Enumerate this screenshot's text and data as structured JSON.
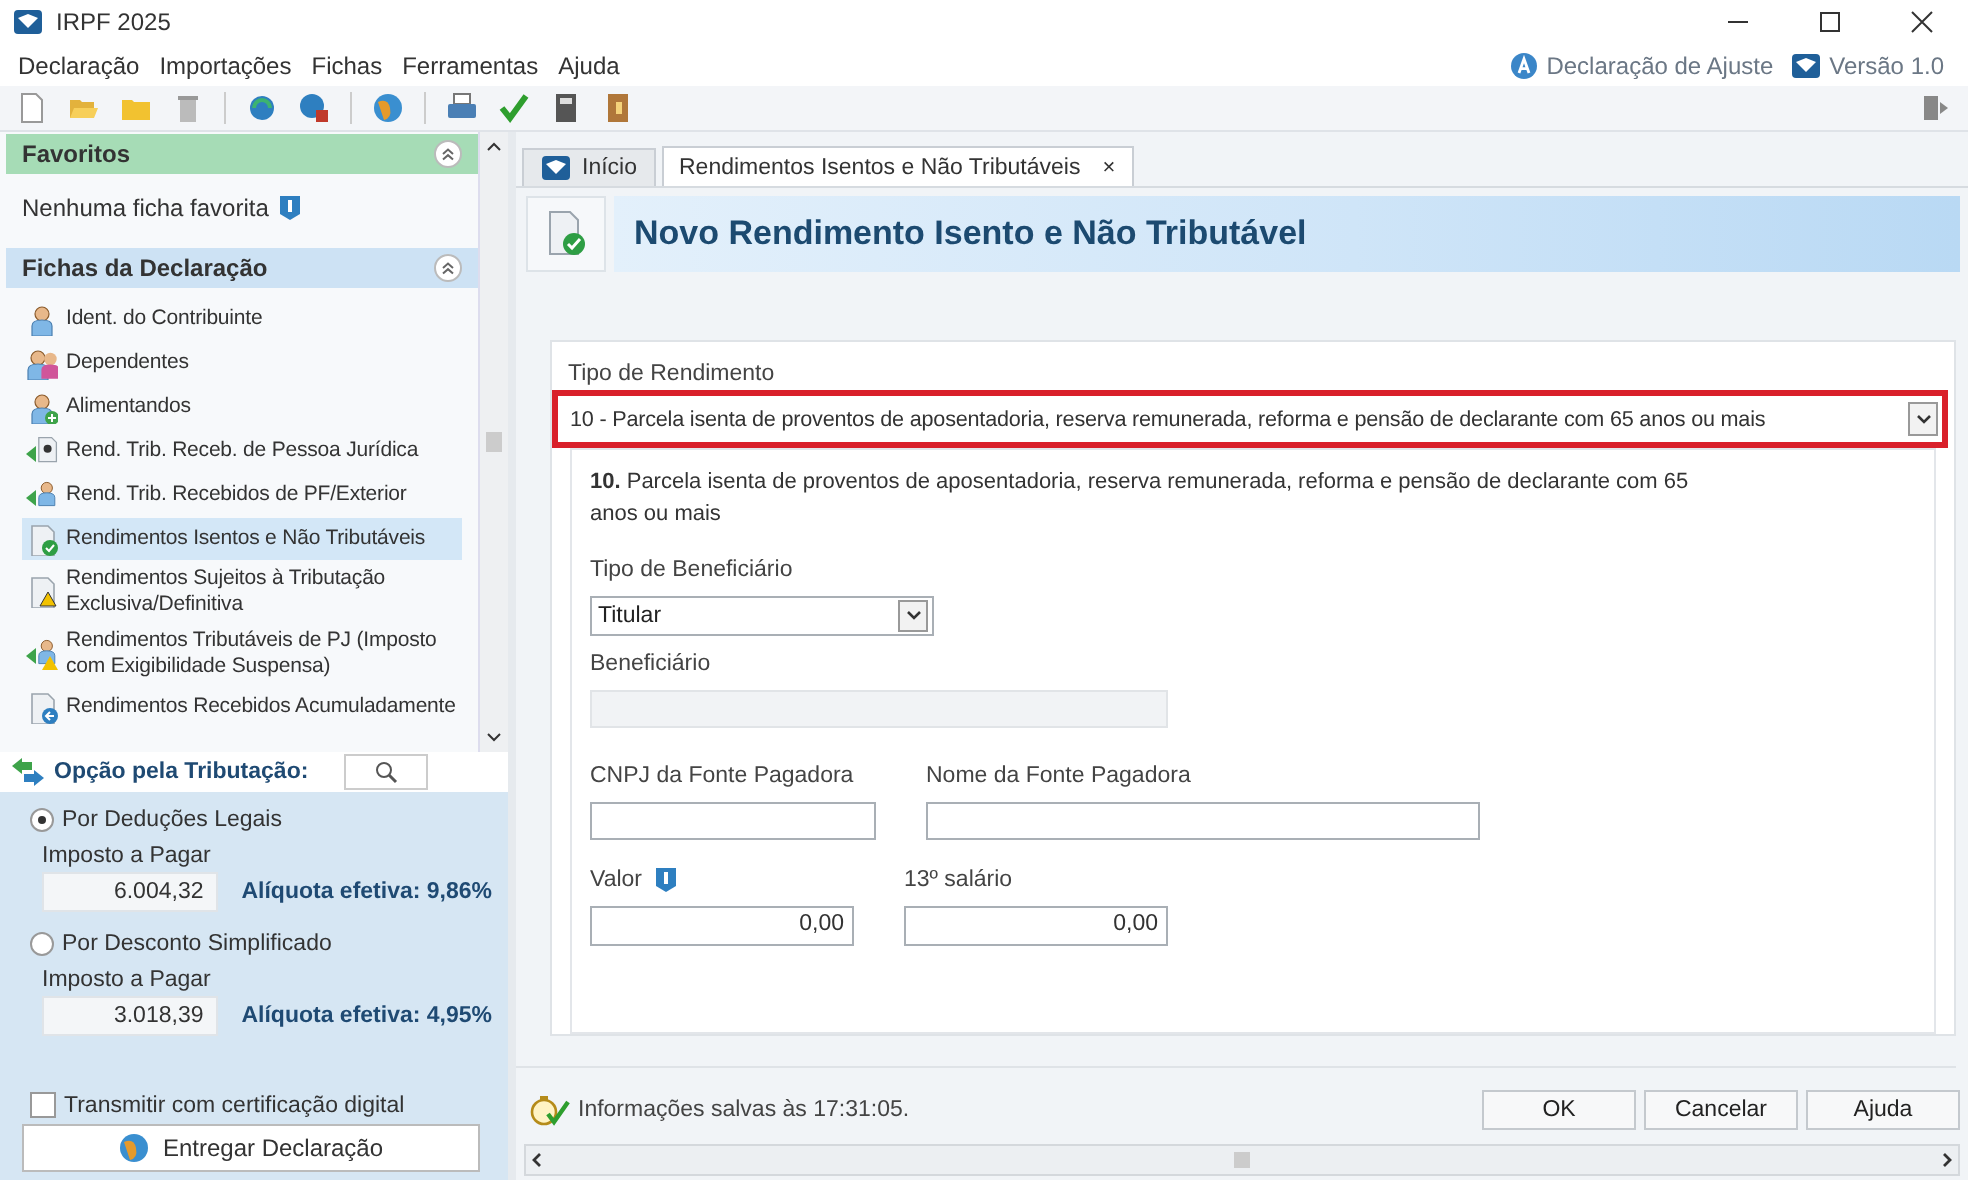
{
  "window": {
    "title": "IRPF 2025"
  },
  "menu": [
    "Declaração",
    "Importações",
    "Fichas",
    "Ferramentas",
    "Ajuda"
  ],
  "header_links": [
    "Declaração de Ajuste",
    "Versão 1.0"
  ],
  "favorites": {
    "title": "Favoritos",
    "empty_text": "Nenhuma ficha favorita"
  },
  "fichas": {
    "title": "Fichas da Declaração",
    "items": [
      {
        "label": "Ident. do Contribuinte",
        "selected": false
      },
      {
        "label": "Dependentes",
        "selected": false
      },
      {
        "label": "Alimentandos",
        "selected": false
      },
      {
        "label": "Rend. Trib. Receb. de Pessoa Jurídica",
        "selected": false
      },
      {
        "label": "Rend. Trib. Recebidos de PF/Exterior",
        "selected": false
      },
      {
        "label": "Rendimentos Isentos e Não Tributáveis",
        "selected": true
      },
      {
        "label": "Rendimentos Sujeitos à Tributação Exclusiva/Definitiva",
        "selected": false
      },
      {
        "label": "Rendimentos Tributáveis de PJ (Imposto com Exigibilidade Suspensa)",
        "selected": false
      },
      {
        "label": "Rendimentos Recebidos Acumuladamente",
        "selected": false
      }
    ]
  },
  "tax_option": {
    "title": "Opção pela Tributação:",
    "options": [
      {
        "label": "Por Deduções Legais",
        "selected": true,
        "amount_label": "Imposto a Pagar",
        "amount": "6.004,32",
        "rate": "Alíquota efetiva: 9,86%"
      },
      {
        "label": "Por Desconto Simplificado",
        "selected": false,
        "amount_label": "Imposto a Pagar",
        "amount": "3.018,39",
        "rate": "Alíquota efetiva: 4,95%"
      }
    ]
  },
  "certificate": {
    "label": "Transmitir com certificação digital",
    "checked": false
  },
  "submit_button": "Entregar Declaração",
  "tabs": [
    {
      "label": "Início",
      "selected": false
    },
    {
      "label": "Rendimentos Isentos e Não Tributáveis",
      "selected": true,
      "close": "×"
    }
  ],
  "page_title": "Novo Rendimento Isento e Não Tributável",
  "form": {
    "type_label": "Tipo de Rendimento",
    "type_value": "10 - Parcela isenta de proventos de aposentadoria, reserva remunerada, reforma e pensão de declarante com 65 anos ou mais",
    "type_highlighted": true,
    "description": "**10.** Parcela isenta de proventos de aposentadoria, reserva remunerada, reforma e pensão de declarante com 65 anos ou mais",
    "beneficiary_type": {
      "label": "Tipo de Beneficiário",
      "value": "Titular"
    },
    "beneficiary": {
      "label": "Beneficiário",
      "disabled": true
    },
    "cnpj": {
      "label": "CNPJ da Fonte Pagadora"
    },
    "payer_name": {
      "label": "Nome da Fonte Pagadora"
    },
    "value": {
      "label": "Valor",
      "value": "0,00"
    },
    "thirteenth": {
      "label": "13º salário",
      "value": "0,00"
    }
  },
  "status": "Informações salvas às 17:31:05.",
  "buttons": [
    "OK",
    "Cancelar",
    "Ajuda"
  ]
}
